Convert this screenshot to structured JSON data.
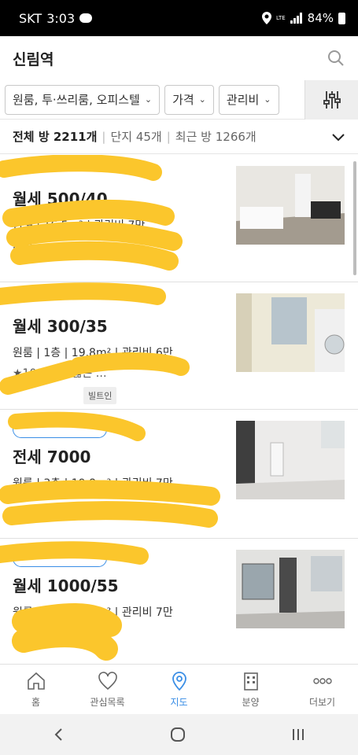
{
  "status_bar": {
    "carrier": "SKT",
    "time": "3:03",
    "network": "LTE",
    "battery": "84%"
  },
  "header": {
    "title": "신림역"
  },
  "filters": {
    "room_type": "원룸, 투·쓰리룸, 오피스텔",
    "price": "가격",
    "maintenance": "관리비"
  },
  "summary": {
    "total": "전체 방 2211개",
    "complex": "단지 45개",
    "recent": "최근 방 1266개"
  },
  "listings": [
    {
      "price": "월세 500/40",
      "info": "원룸 | 16.5m² | 관리비 7만",
      "desc": "지진",
      "badges": [],
      "tag": ""
    },
    {
      "price": "월세 300/35",
      "info": "원룸 | 1층 | 19.8m² | 관리비 6만",
      "desc": "★100% … 넓은 …",
      "badges": [
        "빌트인"
      ],
      "tag": ""
    },
    {
      "price": "전세 7000",
      "info": "원룸 | 3층 | 19.8m² | 관리비 7만",
      "desc": "",
      "badges": [],
      "tag": ""
    },
    {
      "price": "월세 1000/55",
      "info": "원룸 | 3층 | 19.8m² | 관리비 7만",
      "desc": "",
      "badges": [],
      "tag": ""
    }
  ],
  "bottom_nav": {
    "home": "홈",
    "favorites": "관심목록",
    "map": "지도",
    "sale": "분양",
    "more": "더보기"
  },
  "colors": {
    "accent": "#3a8ee6",
    "scribble": "#fbc62c"
  },
  "icons": [
    "search-icon",
    "chevron-down-icon",
    "filter-sliders-icon",
    "home-icon",
    "heart-icon",
    "map-pin-icon",
    "building-icon",
    "more-icon",
    "back-icon",
    "home-circle-icon",
    "recents-icon"
  ]
}
